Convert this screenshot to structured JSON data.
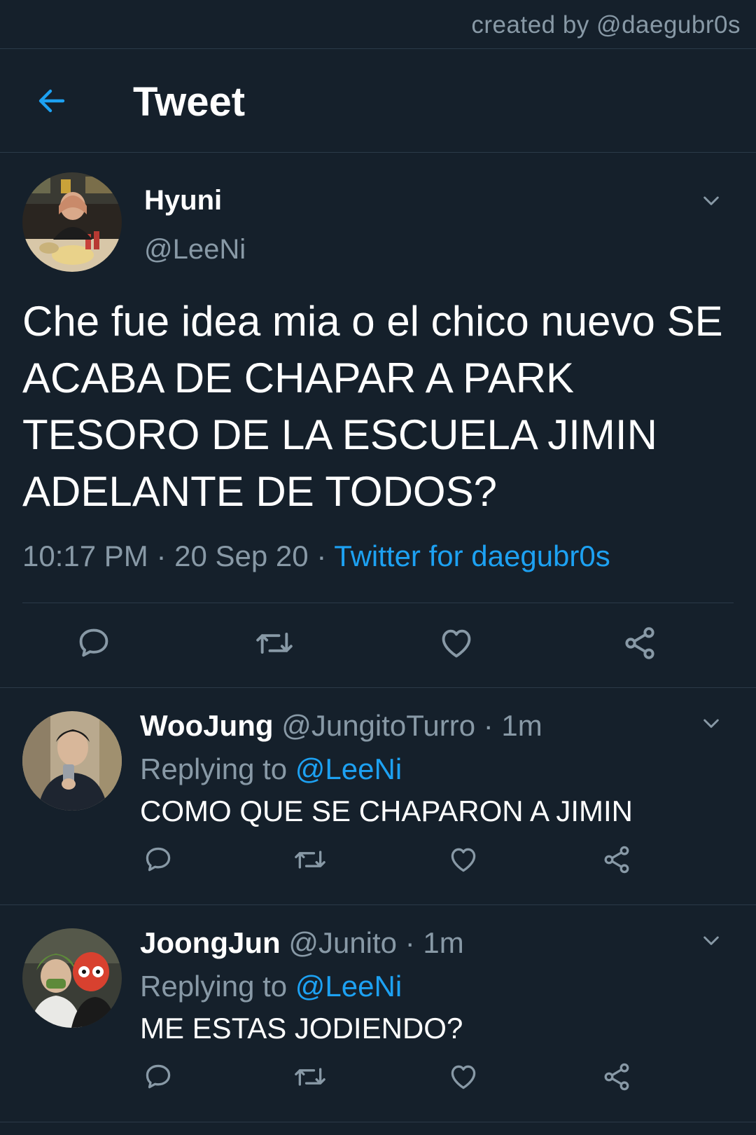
{
  "credit": "created by @daegubr0s",
  "header": {
    "title": "Tweet",
    "back_icon": "arrow-left-icon"
  },
  "colors": {
    "background": "#15202b",
    "accent": "#1da1f2",
    "secondary_text": "#8899a6",
    "divider": "#2b3a48"
  },
  "main_tweet": {
    "name": "Hyuni",
    "handle": "@LeeNi",
    "text": "Che fue idea mia o el chico nuevo SE ACABA DE CHAPAR A PARK TESORO DE LA ESCUELA JIMIN ADELANTE DE TODOS?",
    "time": "10:17 PM",
    "date": "20 Sep 20",
    "separator": "·",
    "source": "Twitter for daegubr0s",
    "actions": [
      "reply-icon",
      "retweet-icon",
      "like-icon",
      "share-icon"
    ]
  },
  "replies": [
    {
      "name": "WooJung",
      "handle": "@JungitoTurro",
      "separator": "·",
      "time": "1m",
      "replying_prefix": "Replying to",
      "replying_to": "@LeeNi",
      "text": "COMO QUE SE CHAPARON A JIMIN"
    },
    {
      "name": "JoongJun",
      "handle": "@Junito",
      "separator": "·",
      "time": "1m",
      "replying_prefix": "Replying to",
      "replying_to": "@LeeNi",
      "text": "ME ESTAS JODIENDO?"
    }
  ]
}
